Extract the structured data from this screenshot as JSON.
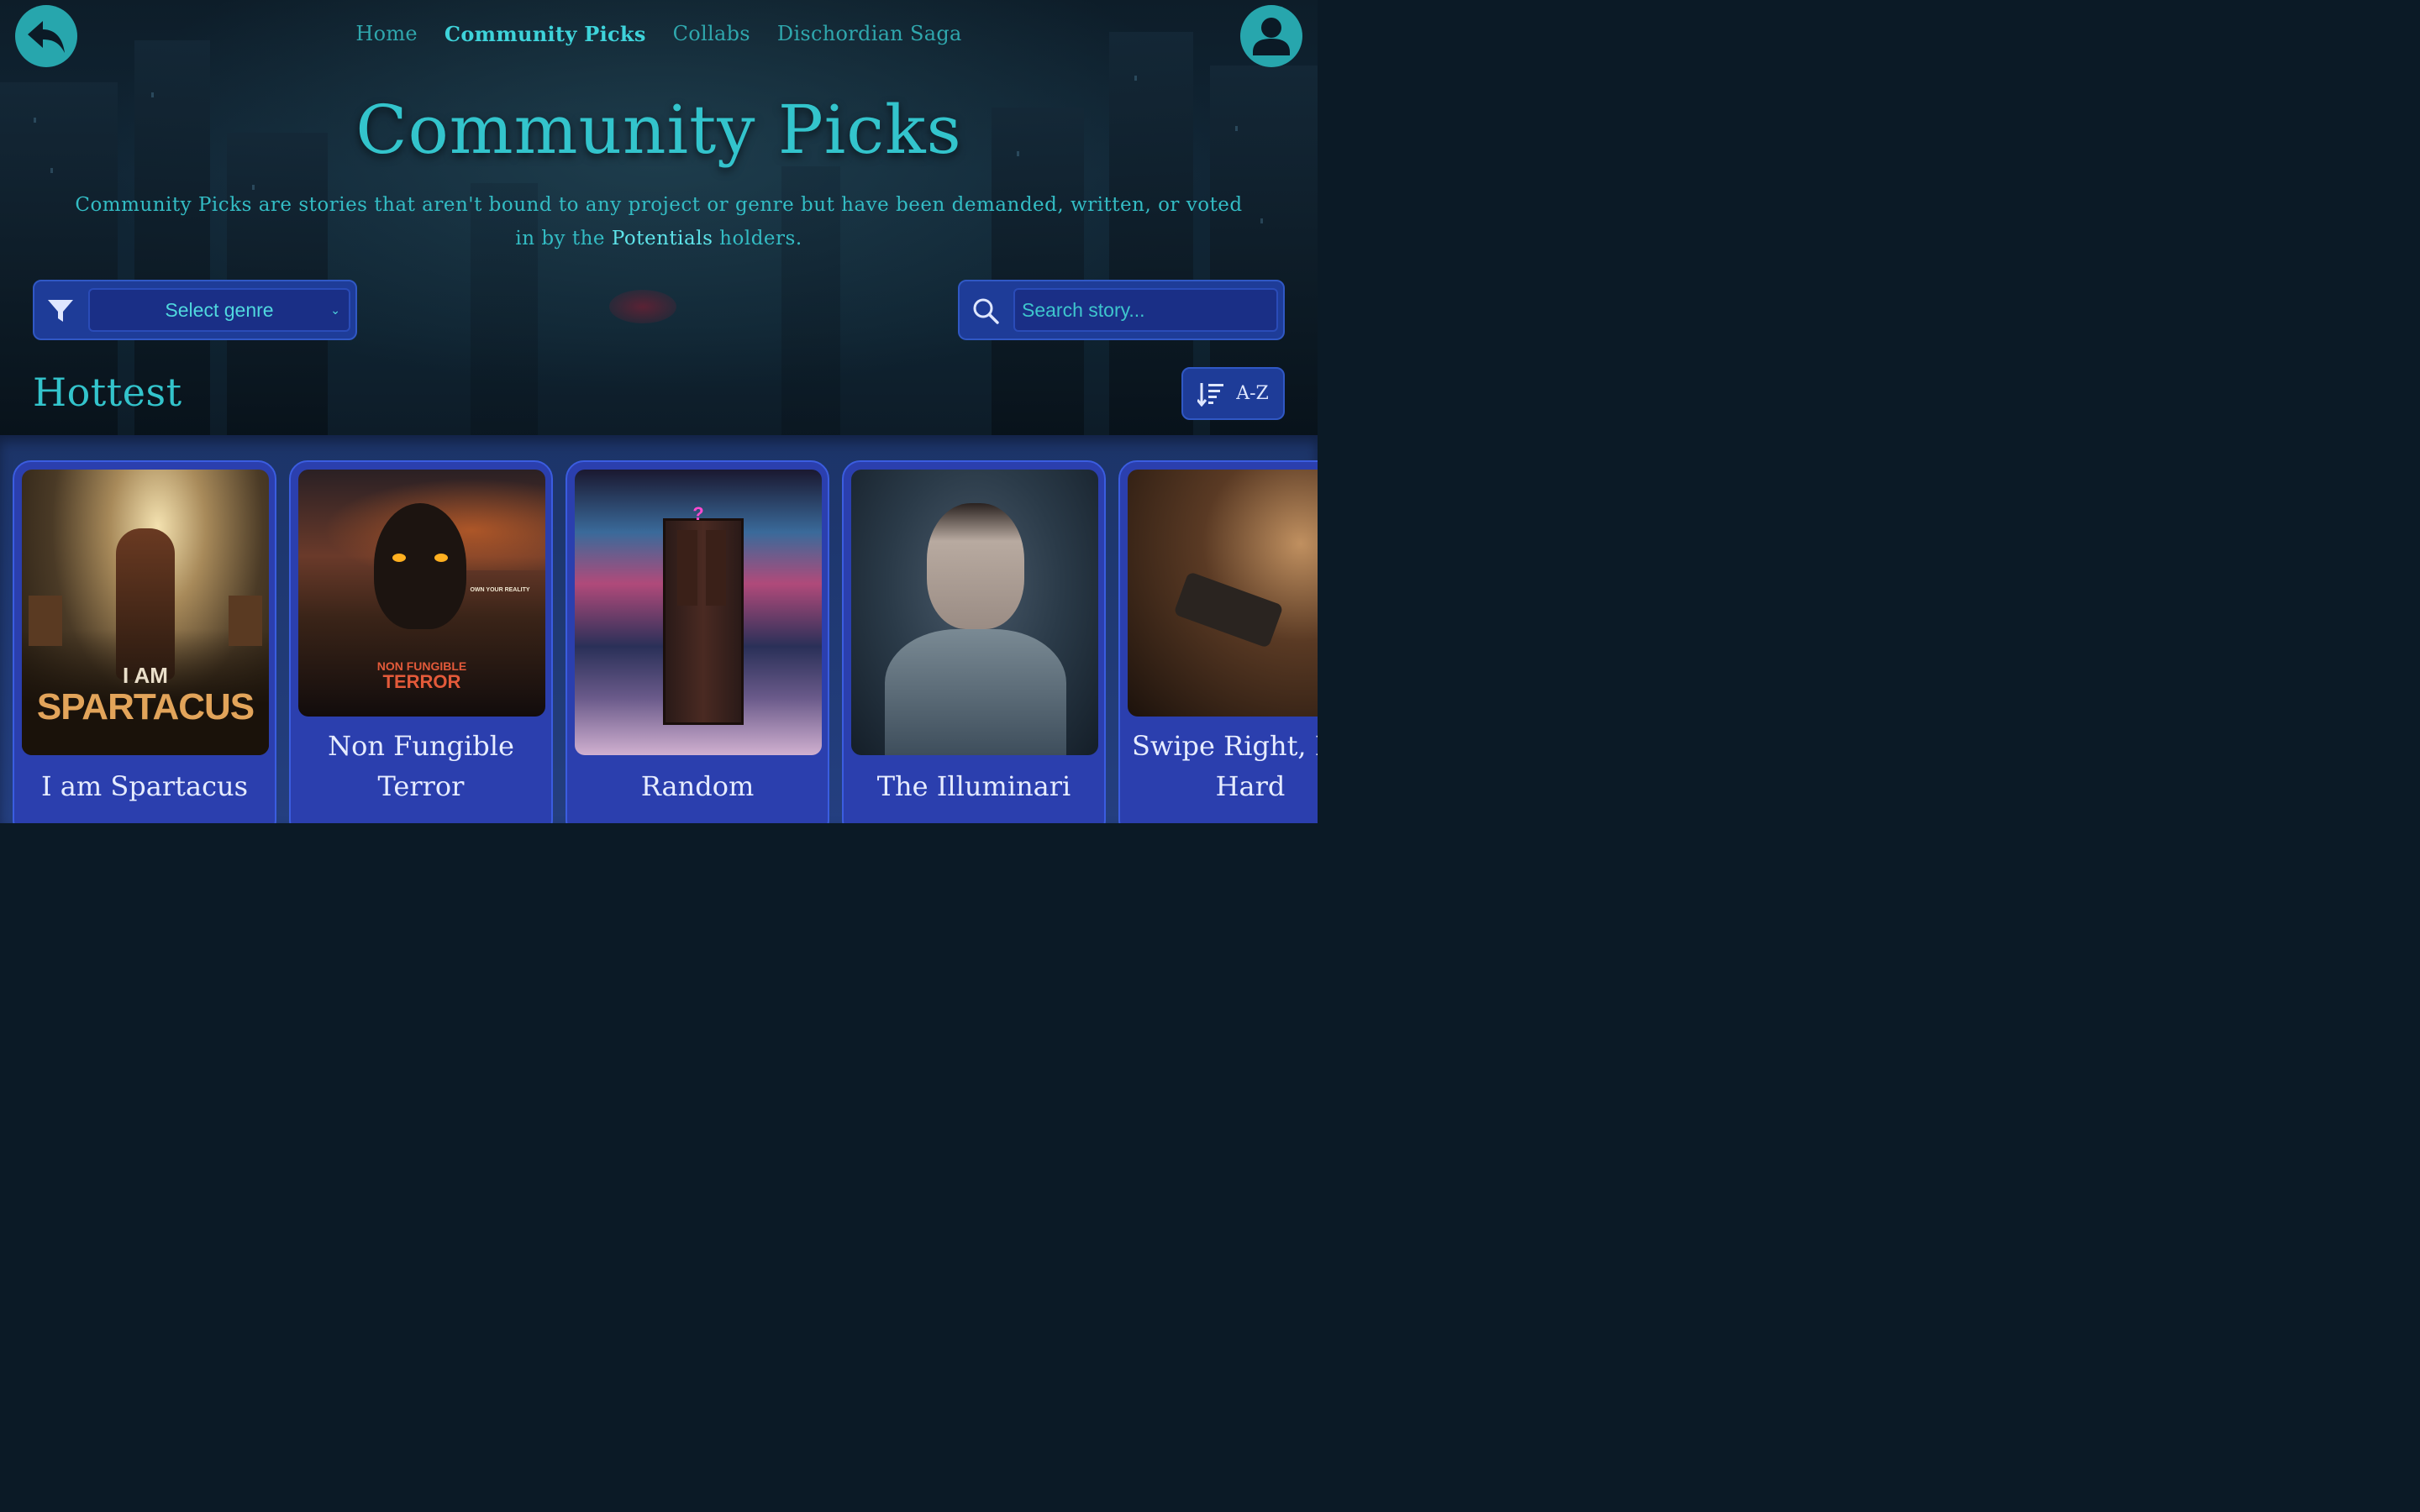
{
  "nav": {
    "items": [
      {
        "label": "Home",
        "active": false
      },
      {
        "label": "Community Picks",
        "active": true
      },
      {
        "label": "Collabs",
        "active": false
      },
      {
        "label": "Dischordian Saga",
        "active": false
      }
    ]
  },
  "header": {
    "title": "Community Picks",
    "description_part1": "Community Picks are stories that aren't bound to any project or genre but have been demanded, written, or voted in by the ",
    "description_highlight": "Potentials",
    "description_part2": " holders."
  },
  "filter": {
    "genre_selected": "Select genre",
    "options": [
      "Select genre"
    ]
  },
  "search": {
    "placeholder": "Search story..."
  },
  "section": {
    "title": "Hottest"
  },
  "sort": {
    "label": "A-Z"
  },
  "cards": [
    {
      "title": "I am Spartacus",
      "poster_line1": "I AM",
      "poster_line2": "SPARTACUS"
    },
    {
      "title": "Non Fungible Terror",
      "title_line1": "Non Fungible",
      "title_line2": "Terror",
      "poster_line1": "NON FUNGIBLE",
      "poster_line2": "TERROR",
      "poster_tagline": "OWN YOUR REALITY"
    },
    {
      "title": "Random",
      "poster_symbol": "?"
    },
    {
      "title": "The Illuminari"
    },
    {
      "title": "Swipe Right, Hard",
      "title_line1": "Swipe Right, I",
      "title_line2": "Hard"
    }
  ],
  "colors": {
    "accent": "#33c4cc",
    "card_bg": "#2b3fae",
    "panel_bg": "#1e3c98",
    "hero_bg": "#0f2331"
  },
  "icons": {
    "back": "back-arrow-icon",
    "user": "user-icon",
    "filter": "filter-icon",
    "search": "search-icon",
    "sort": "sort-icon"
  }
}
